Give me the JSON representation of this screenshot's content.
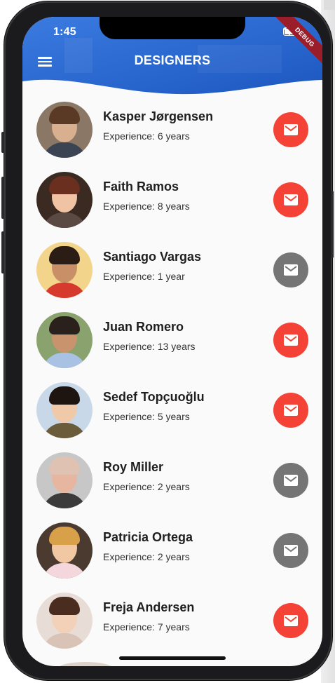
{
  "status_bar": {
    "time": "1:45"
  },
  "app_bar": {
    "title": "DESIGNERS",
    "menu_icon": "menu-icon",
    "debug_banner": "DEBUG",
    "gradient": [
      "#2f6fd6",
      "#1a58c4"
    ]
  },
  "colors": {
    "mail_active": "#f44336",
    "mail_inactive": "#757575",
    "background": "#fafafa"
  },
  "designers": [
    {
      "name": "Kasper Jørgensen",
      "experience": "Experience: 6 years",
      "mail_active": true,
      "avatar": {
        "bg": "#8a7766",
        "skin": "#d9b08f",
        "hair": "#5a3a24",
        "body": "#3b4452"
      }
    },
    {
      "name": "Faith Ramos",
      "experience": "Experience: 8 years",
      "mail_active": true,
      "avatar": {
        "bg": "#3a2a22",
        "skin": "#f0c3a5",
        "hair": "#6b2f1f",
        "body": "#5b4a44"
      }
    },
    {
      "name": "Santiago Vargas",
      "experience": "Experience: 1 year",
      "mail_active": false,
      "avatar": {
        "bg": "#f2d48a",
        "skin": "#c98f67",
        "hair": "#2b1d15",
        "body": "#d63a2f"
      }
    },
    {
      "name": "Juan Romero",
      "experience": "Experience: 13 years",
      "mail_active": true,
      "avatar": {
        "bg": "#8aa36e",
        "skin": "#c9936d",
        "hair": "#2a211c",
        "body": "#a9c2e3"
      }
    },
    {
      "name": "Sedef Topçuoğlu",
      "experience": "Experience: 5 years",
      "mail_active": true,
      "avatar": {
        "bg": "#c8d8e8",
        "skin": "#f0c9a8",
        "hair": "#1e1510",
        "body": "#6b5c3b"
      }
    },
    {
      "name": "Roy Miller",
      "experience": "Experience: 2 years",
      "mail_active": false,
      "avatar": {
        "bg": "#c7c7c7",
        "skin": "#e7b6a0",
        "hair": "#e0c2b2",
        "body": "#3b3b3b"
      }
    },
    {
      "name": "Patricia Ortega",
      "experience": "Experience: 2 years",
      "mail_active": false,
      "avatar": {
        "bg": "#4a3a30",
        "skin": "#f1c7a4",
        "hair": "#d9a04a",
        "body": "#f3d7dc"
      }
    },
    {
      "name": "Freja Andersen",
      "experience": "Experience: 7 years",
      "mail_active": true,
      "avatar": {
        "bg": "#e8ddd6",
        "skin": "#f3d0b8",
        "hair": "#4a2d1f",
        "body": "#d8c3b6"
      }
    }
  ]
}
